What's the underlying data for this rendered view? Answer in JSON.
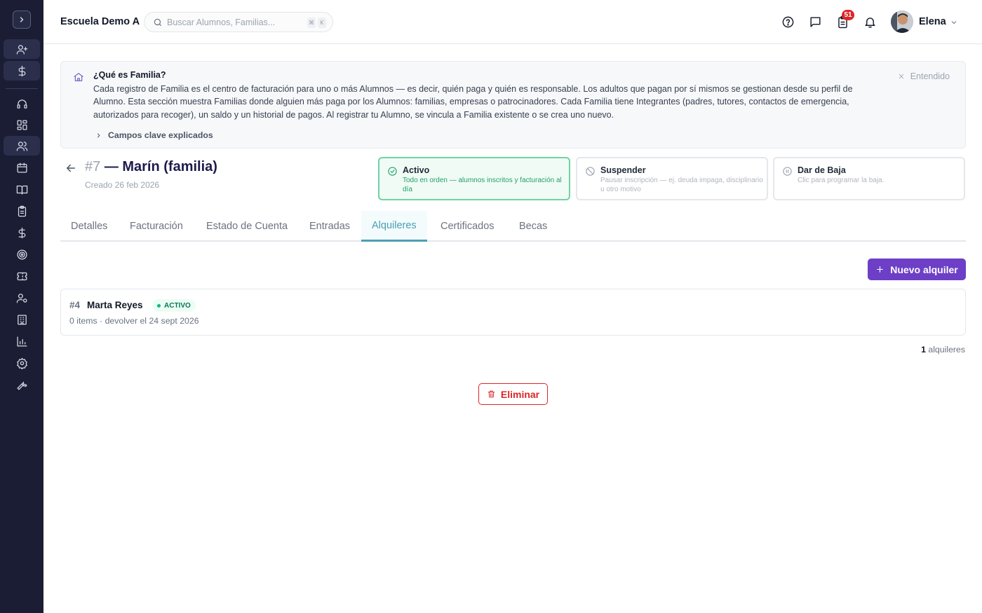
{
  "sidebar": {
    "items": [
      {
        "icon": "user-plus-icon"
      },
      {
        "icon": "dollar-icon"
      },
      {
        "icon": "headset-icon"
      },
      {
        "icon": "dashboard-icon"
      },
      {
        "icon": "users-icon"
      },
      {
        "icon": "calendar-icon"
      },
      {
        "icon": "book-icon"
      },
      {
        "icon": "clipboard-icon"
      },
      {
        "icon": "dollar-icon"
      },
      {
        "icon": "target-icon"
      },
      {
        "icon": "ticket-icon"
      },
      {
        "icon": "user-settings-icon"
      },
      {
        "icon": "building-icon"
      },
      {
        "icon": "bar-chart-icon"
      },
      {
        "icon": "gear-icon"
      },
      {
        "icon": "wrench-icon"
      }
    ]
  },
  "header": {
    "school_name": "Escuela Demo A",
    "search_placeholder": "Buscar Alumnos, Familias...",
    "search_shortcut": [
      "⌘",
      "K"
    ],
    "notifications_count": "51",
    "user_name": "Elena"
  },
  "info": {
    "title": "¿Qué es Familia?",
    "body": "Cada registro de Familia es el centro de facturación para uno o más Alumnos — es decir, quién paga y quién es responsable. Los adultos que pagan por sí mismos se gestionan desde su perfil de Alumno. Esta sección muestra Familias donde alguien más paga por los Alumnos: familias, empresas o patrocinadores. Cada Familia tiene Integrantes (padres, tutores, contactos de emergencia, autorizados para recoger), un saldo y un historial de pagos. Al registrar tu Alumno, se vincula a Familia existente o se crea uno nuevo.",
    "more_label": "Campos clave explicados",
    "dismiss_label": "Entendido"
  },
  "family": {
    "id": "#7",
    "name": "— Marín (familia)",
    "created": "Creado 26 feb 2026"
  },
  "status_options": [
    {
      "title": "Activo",
      "desc": "Todo en orden — alumnos inscritos y facturación al día",
      "selected": true
    },
    {
      "title": "Suspender",
      "desc": "Pausar inscripción — ej. deuda impaga, disciplinario u otro motivo",
      "selected": false
    },
    {
      "title": "Dar de Baja",
      "desc": "Clic para programar la baja.",
      "selected": false
    }
  ],
  "tabs": [
    {
      "label": "Detalles"
    },
    {
      "label": "Facturación"
    },
    {
      "label": "Estado de Cuenta"
    },
    {
      "label": "Entradas"
    },
    {
      "label": "Alquileres",
      "active": true
    },
    {
      "label": "Certificados"
    },
    {
      "label": "Becas"
    }
  ],
  "rentals": {
    "new_button": "Nuevo alquiler",
    "items": [
      {
        "number": "#4",
        "name": "Marta Reyes",
        "status": "ACTIVO",
        "meta": "0 items · devolver el 24 sept 2026"
      }
    ],
    "count_value": "1",
    "count_label": "alquileres"
  },
  "delete_button": "Eliminar",
  "colors": {
    "sidebar_bg": "#1a1d33",
    "accent_purple": "#6d3fc7",
    "tab_active": "#4a9fb3",
    "status_active_border": "#6fd3a3",
    "danger": "#dc2626"
  }
}
